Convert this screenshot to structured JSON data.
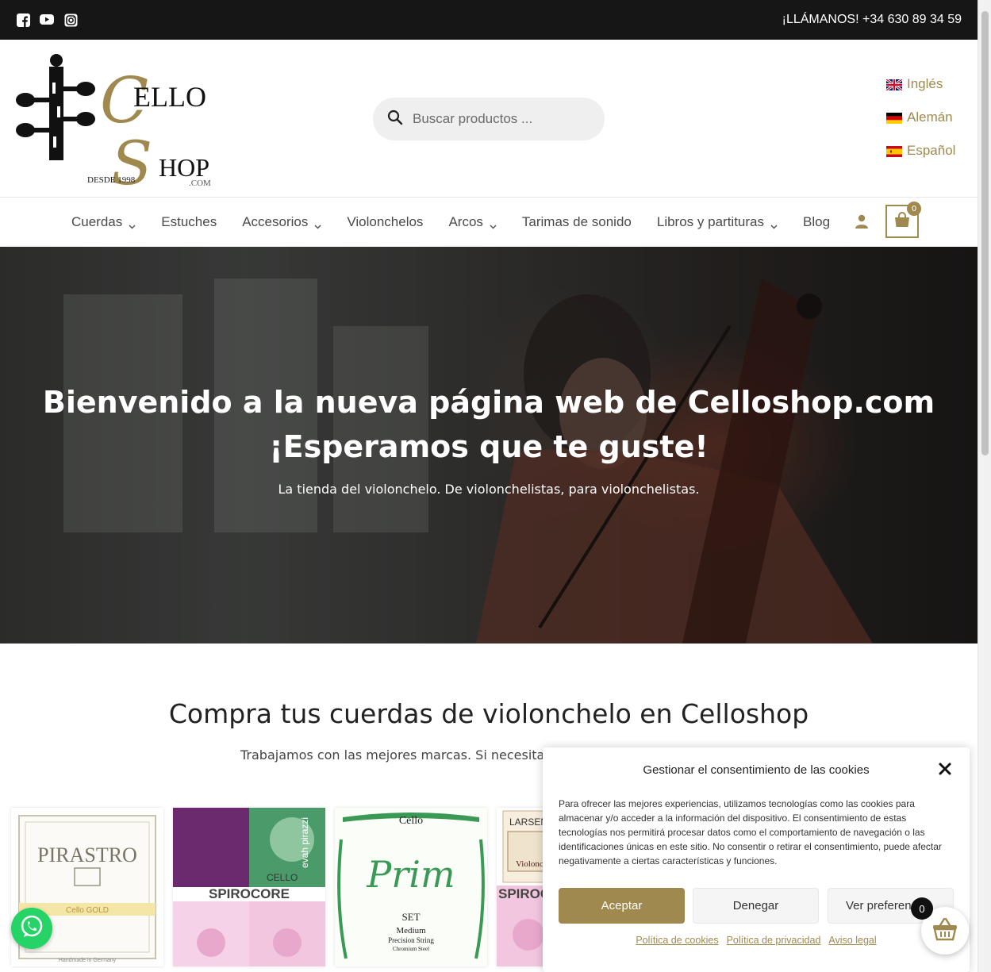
{
  "topbar": {
    "phone": "¡LLÁMANOS! +34 630 89 34 59",
    "social_icons": [
      "facebook-icon",
      "youtube-icon",
      "instagram-icon"
    ]
  },
  "header": {
    "logo_text_1": "ELLO",
    "logo_text_2": "HOP",
    "logo_initial_1": "C",
    "logo_initial_2": "S",
    "logo_com": ".COM",
    "logo_since": "DESDE 1998",
    "search_placeholder": "Buscar productos ...",
    "languages": [
      {
        "label": "Inglés",
        "flag": "uk-flag-icon"
      },
      {
        "label": "Alemán",
        "flag": "germany-flag-icon"
      },
      {
        "label": "Español",
        "flag": "spain-flag-icon"
      }
    ]
  },
  "nav": {
    "items": [
      {
        "label": "Cuerdas",
        "dropdown": true
      },
      {
        "label": "Estuches",
        "dropdown": false
      },
      {
        "label": "Accesorios",
        "dropdown": true
      },
      {
        "label": "Violonchelos",
        "dropdown": false
      },
      {
        "label": "Arcos",
        "dropdown": true
      },
      {
        "label": "Tarimas de sonido",
        "dropdown": false
      },
      {
        "label": "Libros y partituras",
        "dropdown": true
      },
      {
        "label": "Blog",
        "dropdown": false
      }
    ],
    "cart_count": "0"
  },
  "hero": {
    "title_line1": "Bienvenido a la nueva página web de Celloshop.com",
    "title_line2": "¡Esperamos que te guste!",
    "subtitle": "La tienda del violonchelo. De violonchelistas, para violonchelistas."
  },
  "section": {
    "title": "Compra tus cuerdas de violonchelo en Celloshop",
    "subtitle": "Trabajamos con las mejores marcas. Si necesitas co"
  },
  "products": [
    {
      "brand": "PIRASTRO",
      "label": "Cello GOLD",
      "footer": "Handmade in Germany"
    },
    {
      "brand": "SPIROCORE",
      "label": "CELLO",
      "footer": "evah pirazzi"
    },
    {
      "brand": "Prim",
      "label": "SET",
      "sub1": "Medium",
      "sub2": "Precision String",
      "sub3": "Chromium Steel",
      "top": "Cello"
    },
    {
      "brand": "LARSEN STR",
      "label": "Violoncell",
      "footer": "SPIROC"
    },
    {
      "brand": "",
      "label": ""
    }
  ],
  "cookie": {
    "title": "Gestionar el consentimiento de las cookies",
    "text": "Para ofrecer las mejores experiencias, utilizamos tecnologías como las cookies para almacenar y/o acceder a la información del dispositivo. El consentimiento de estas tecnologías nos permitirá procesar datos como el comportamiento de navegación o las identificaciones únicas en este sitio. No consentir o retirar el consentimiento, puede afectar negativamente a ciertas características y funciones.",
    "accept": "Aceptar",
    "deny": "Denegar",
    "prefs": "Ver preferencias",
    "links": [
      "Política de cookies",
      "Política de privacidad",
      "Aviso legal"
    ]
  },
  "floating": {
    "cart_count": "0"
  },
  "colors": {
    "accent": "#a0894f",
    "topbar": "#161616",
    "whatsapp": "#25d366"
  }
}
